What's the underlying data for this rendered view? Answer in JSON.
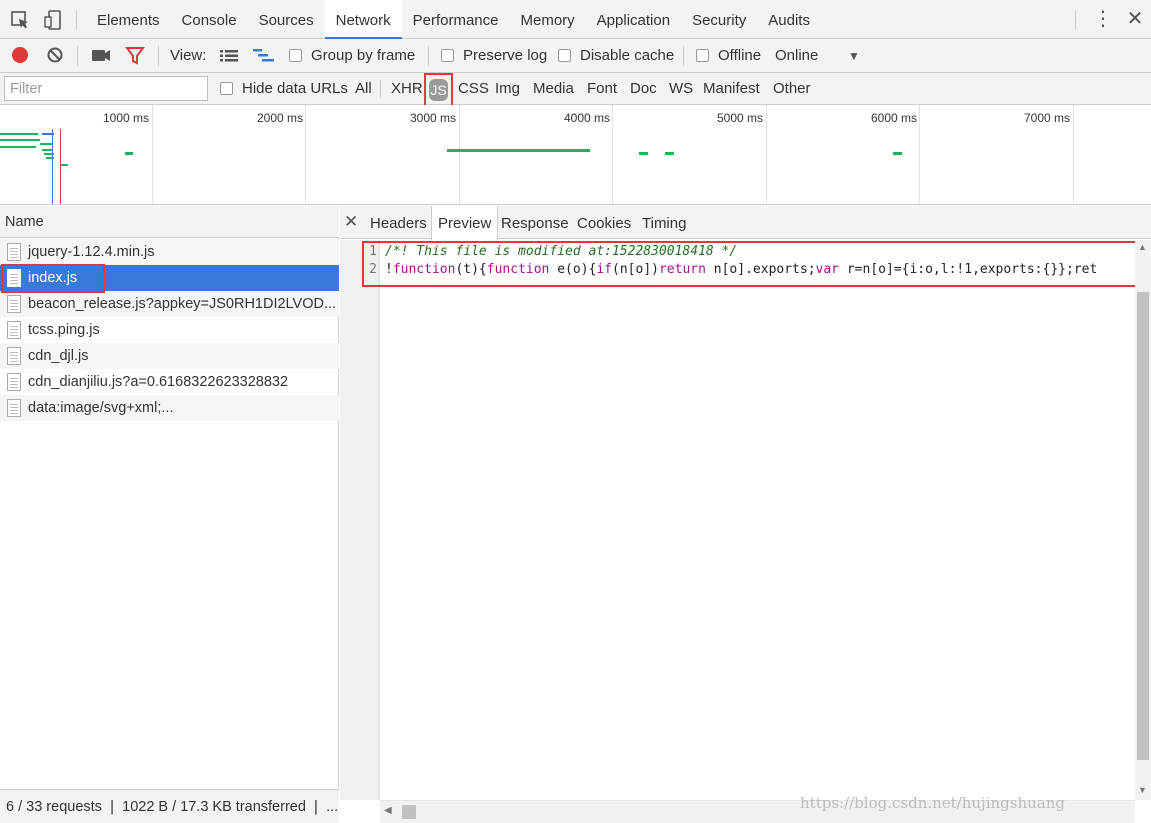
{
  "devtools": {
    "tabs": [
      "Elements",
      "Console",
      "Sources",
      "Network",
      "Performance",
      "Memory",
      "Application",
      "Security",
      "Audits"
    ],
    "active_tab": "Network"
  },
  "toolbar": {
    "view_label": "View:",
    "group_by_frame": "Group by frame",
    "preserve_log": "Preserve log",
    "disable_cache": "Disable cache",
    "offline": "Offline",
    "online": "Online"
  },
  "filterbar": {
    "placeholder": "Filter",
    "hide_data_urls": "Hide data URLs",
    "types": [
      "All",
      "XHR",
      "JS",
      "CSS",
      "Img",
      "Media",
      "Font",
      "Doc",
      "WS",
      "Manifest",
      "Other"
    ],
    "active_type": "JS"
  },
  "overview": {
    "ticks": [
      "1000 ms",
      "2000 ms",
      "3000 ms",
      "4000 ms",
      "5000 ms",
      "6000 ms",
      "7000 ms"
    ]
  },
  "requests": {
    "header": "Name",
    "items": [
      "jquery-1.12.4.min.js",
      "index.js",
      "beacon_release.js?appkey=JS0RH1DI2LVOD...",
      "tcss.ping.js",
      "cdn_djl.js",
      "cdn_dianjiliu.js?a=0.6168322623328832",
      "data:image/svg+xml;..."
    ],
    "selected": "index.js",
    "status": "6 / 33 requests  ❘  1022 B / 17.3 KB transferred  ❘  ..."
  },
  "detail": {
    "tabs": [
      "Headers",
      "Preview",
      "Response",
      "Cookies",
      "Timing"
    ],
    "active_tab": "Preview",
    "line_numbers": [
      "1",
      "2"
    ],
    "line1": "/*! This file is modified at:1522830018418 */",
    "line2": {
      "t1": "!",
      "t2": "function",
      "t3": "(t){",
      "t4": "function",
      "t5": " e(o){",
      "t6": "if",
      "t7": "(n[o])",
      "t8": "return",
      "t9": " n[o].exports;",
      "t10": "var",
      "t11": " r=n[o]={i:o,l:!1,exports:{}};ret"
    }
  },
  "watermark": "https://blog.csdn.net/hujingshuang",
  "colors": {
    "accent": "#3879d9",
    "highlight_box": "#e0393b",
    "record": "#e0393b",
    "timeline_bar": "#1fb35b"
  }
}
